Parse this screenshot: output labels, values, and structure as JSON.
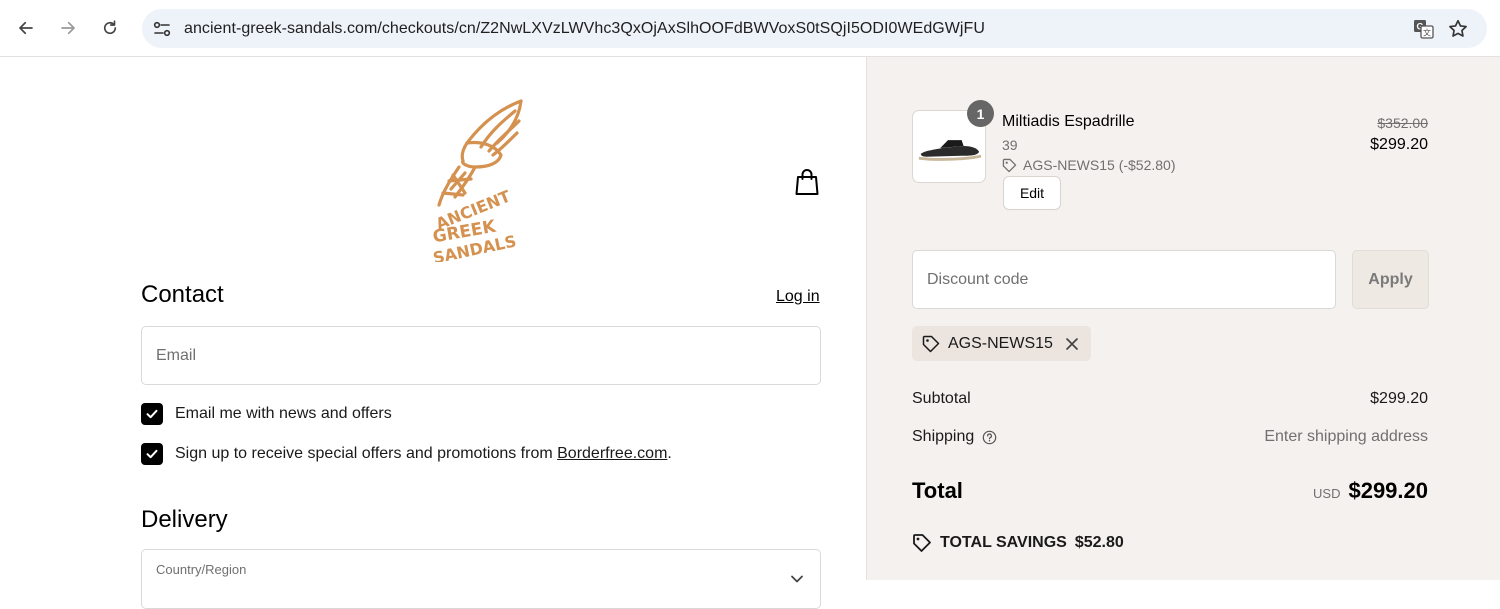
{
  "browser": {
    "url": "ancient-greek-sandals.com/checkouts/cn/Z2NwLXVzLWVhc3QxOjAxSlhOOFdBWVoxS0tSQjI5ODI0WEdGWjFU"
  },
  "header": {
    "logo_text": "ANCIENT GREEK SANDALS"
  },
  "contact": {
    "title": "Contact",
    "login_label": "Log in",
    "email_placeholder": "Email",
    "news_checkbox_label": "Email me with news and offers",
    "promo_checkbox_prefix": "Sign up to receive special offers and promotions from ",
    "promo_link": "Borderfree.com",
    "promo_suffix": "."
  },
  "delivery": {
    "title": "Delivery",
    "country_label": "Country/Region"
  },
  "order": {
    "item": {
      "quantity": "1",
      "name": "Miltiadis Espadrille",
      "size": "39",
      "discount": "AGS-NEWS15 (-$52.80)",
      "original_price": "$352.00",
      "price": "$299.20",
      "edit_label": "Edit"
    },
    "discount_placeholder": "Discount code",
    "apply_label": "Apply",
    "applied_code": "AGS-NEWS15",
    "subtotal_label": "Subtotal",
    "subtotal_value": "$299.20",
    "shipping_label": "Shipping",
    "shipping_value": "Enter shipping address",
    "total_label": "Total",
    "currency": "USD",
    "total_value": "$299.20",
    "savings_label": "TOTAL SAVINGS",
    "savings_value": "$52.80"
  },
  "colors": {
    "brand": "#d4914f",
    "summary_bg": "#f5f1ee",
    "checkbox": "#000000"
  }
}
